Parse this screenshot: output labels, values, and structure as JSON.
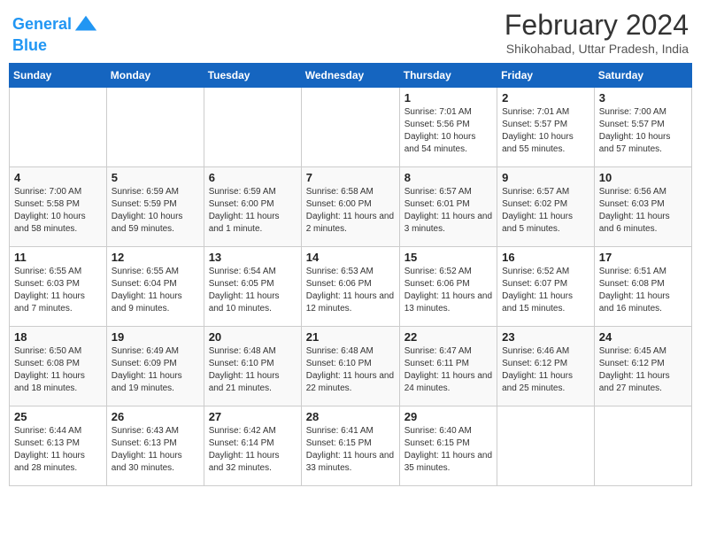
{
  "logo": {
    "line1": "General",
    "line2": "Blue"
  },
  "title": "February 2024",
  "subtitle": "Shikohabad, Uttar Pradesh, India",
  "columns": [
    "Sunday",
    "Monday",
    "Tuesday",
    "Wednesday",
    "Thursday",
    "Friday",
    "Saturday"
  ],
  "weeks": [
    [
      {
        "day": "",
        "info": ""
      },
      {
        "day": "",
        "info": ""
      },
      {
        "day": "",
        "info": ""
      },
      {
        "day": "",
        "info": ""
      },
      {
        "day": "1",
        "info": "Sunrise: 7:01 AM\nSunset: 5:56 PM\nDaylight: 10 hours and 54 minutes."
      },
      {
        "day": "2",
        "info": "Sunrise: 7:01 AM\nSunset: 5:57 PM\nDaylight: 10 hours and 55 minutes."
      },
      {
        "day": "3",
        "info": "Sunrise: 7:00 AM\nSunset: 5:57 PM\nDaylight: 10 hours and 57 minutes."
      }
    ],
    [
      {
        "day": "4",
        "info": "Sunrise: 7:00 AM\nSunset: 5:58 PM\nDaylight: 10 hours and 58 minutes."
      },
      {
        "day": "5",
        "info": "Sunrise: 6:59 AM\nSunset: 5:59 PM\nDaylight: 10 hours and 59 minutes."
      },
      {
        "day": "6",
        "info": "Sunrise: 6:59 AM\nSunset: 6:00 PM\nDaylight: 11 hours and 1 minute."
      },
      {
        "day": "7",
        "info": "Sunrise: 6:58 AM\nSunset: 6:00 PM\nDaylight: 11 hours and 2 minutes."
      },
      {
        "day": "8",
        "info": "Sunrise: 6:57 AM\nSunset: 6:01 PM\nDaylight: 11 hours and 3 minutes."
      },
      {
        "day": "9",
        "info": "Sunrise: 6:57 AM\nSunset: 6:02 PM\nDaylight: 11 hours and 5 minutes."
      },
      {
        "day": "10",
        "info": "Sunrise: 6:56 AM\nSunset: 6:03 PM\nDaylight: 11 hours and 6 minutes."
      }
    ],
    [
      {
        "day": "11",
        "info": "Sunrise: 6:55 AM\nSunset: 6:03 PM\nDaylight: 11 hours and 7 minutes."
      },
      {
        "day": "12",
        "info": "Sunrise: 6:55 AM\nSunset: 6:04 PM\nDaylight: 11 hours and 9 minutes."
      },
      {
        "day": "13",
        "info": "Sunrise: 6:54 AM\nSunset: 6:05 PM\nDaylight: 11 hours and 10 minutes."
      },
      {
        "day": "14",
        "info": "Sunrise: 6:53 AM\nSunset: 6:06 PM\nDaylight: 11 hours and 12 minutes."
      },
      {
        "day": "15",
        "info": "Sunrise: 6:52 AM\nSunset: 6:06 PM\nDaylight: 11 hours and 13 minutes."
      },
      {
        "day": "16",
        "info": "Sunrise: 6:52 AM\nSunset: 6:07 PM\nDaylight: 11 hours and 15 minutes."
      },
      {
        "day": "17",
        "info": "Sunrise: 6:51 AM\nSunset: 6:08 PM\nDaylight: 11 hours and 16 minutes."
      }
    ],
    [
      {
        "day": "18",
        "info": "Sunrise: 6:50 AM\nSunset: 6:08 PM\nDaylight: 11 hours and 18 minutes."
      },
      {
        "day": "19",
        "info": "Sunrise: 6:49 AM\nSunset: 6:09 PM\nDaylight: 11 hours and 19 minutes."
      },
      {
        "day": "20",
        "info": "Sunrise: 6:48 AM\nSunset: 6:10 PM\nDaylight: 11 hours and 21 minutes."
      },
      {
        "day": "21",
        "info": "Sunrise: 6:48 AM\nSunset: 6:10 PM\nDaylight: 11 hours and 22 minutes."
      },
      {
        "day": "22",
        "info": "Sunrise: 6:47 AM\nSunset: 6:11 PM\nDaylight: 11 hours and 24 minutes."
      },
      {
        "day": "23",
        "info": "Sunrise: 6:46 AM\nSunset: 6:12 PM\nDaylight: 11 hours and 25 minutes."
      },
      {
        "day": "24",
        "info": "Sunrise: 6:45 AM\nSunset: 6:12 PM\nDaylight: 11 hours and 27 minutes."
      }
    ],
    [
      {
        "day": "25",
        "info": "Sunrise: 6:44 AM\nSunset: 6:13 PM\nDaylight: 11 hours and 28 minutes."
      },
      {
        "day": "26",
        "info": "Sunrise: 6:43 AM\nSunset: 6:13 PM\nDaylight: 11 hours and 30 minutes."
      },
      {
        "day": "27",
        "info": "Sunrise: 6:42 AM\nSunset: 6:14 PM\nDaylight: 11 hours and 32 minutes."
      },
      {
        "day": "28",
        "info": "Sunrise: 6:41 AM\nSunset: 6:15 PM\nDaylight: 11 hours and 33 minutes."
      },
      {
        "day": "29",
        "info": "Sunrise: 6:40 AM\nSunset: 6:15 PM\nDaylight: 11 hours and 35 minutes."
      },
      {
        "day": "",
        "info": ""
      },
      {
        "day": "",
        "info": ""
      }
    ]
  ]
}
